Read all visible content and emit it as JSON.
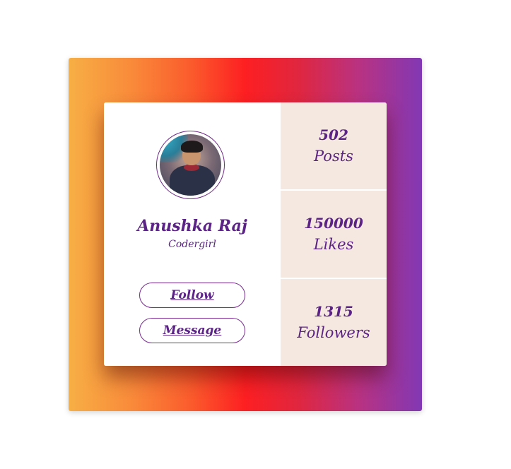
{
  "profile": {
    "name": "Anushka Raj",
    "tagline": "Codergirl"
  },
  "actions": {
    "follow_label": "Follow",
    "message_label": "Message"
  },
  "stats": [
    {
      "value": "502",
      "label": "Posts"
    },
    {
      "value": "150000",
      "label": "Likes"
    },
    {
      "value": "1315",
      "label": "Followers"
    }
  ],
  "colors": {
    "accent": "#5b2385",
    "stats_bg": "#f5e8e0",
    "gradient": [
      "#f7af45",
      "#fd1f22",
      "#8238b4"
    ]
  }
}
